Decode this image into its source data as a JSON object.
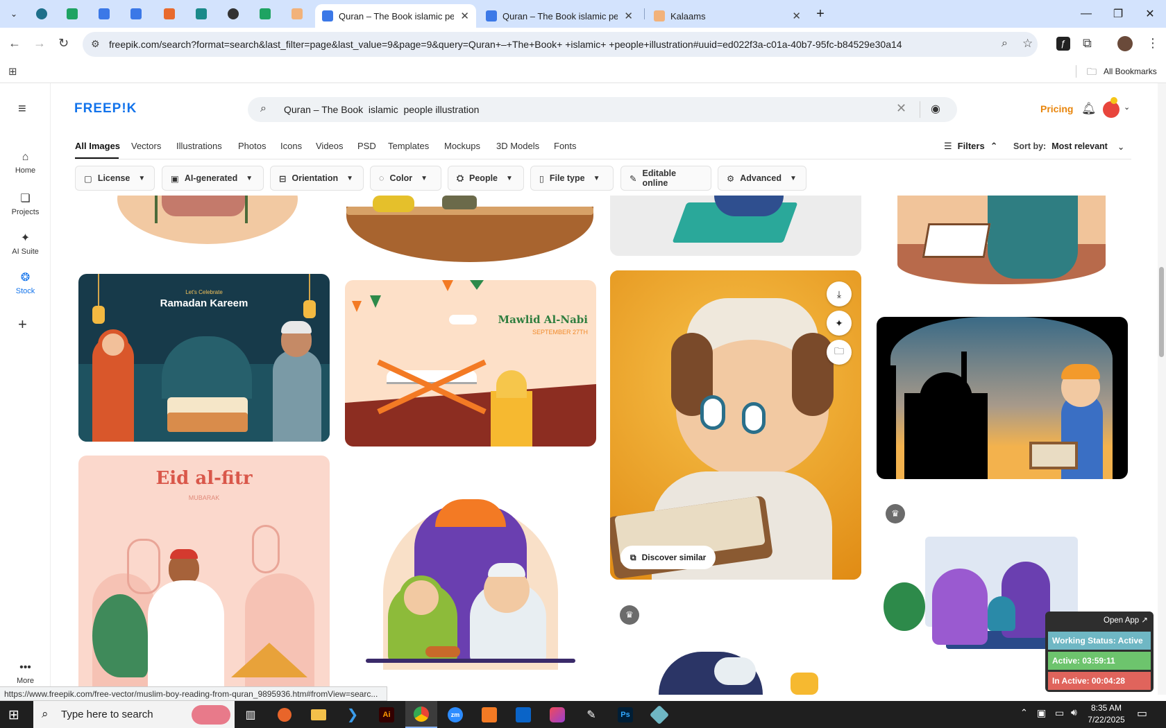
{
  "browser": {
    "tabs": [
      {
        "title": "Quran – The Book islamic peop",
        "active": true
      },
      {
        "title": "Quran – The Book islamic peop",
        "active": false
      },
      {
        "title": "Kalaams",
        "active": false
      }
    ],
    "url": "freepik.com/search?format=search&last_filter=page&last_value=9&page=9&query=Quran+–+The+Book+ +islamic+ +people+illustration#uuid=ed022f3a-c01a-40b7-95fc-b84529e30a14",
    "all_bookmarks": "All Bookmarks"
  },
  "nav": {
    "items": [
      {
        "label": "Home",
        "icon": "home-icon"
      },
      {
        "label": "Projects",
        "icon": "projects-icon"
      },
      {
        "label": "AI Suite",
        "icon": "sparkle-icon"
      },
      {
        "label": "Stock",
        "icon": "stock-icon"
      }
    ],
    "more": "More"
  },
  "header": {
    "logo": "FREEP!K",
    "search_value": "Quran – The Book  islamic  people illustration",
    "pricing": "Pricing"
  },
  "categories": [
    "All Images",
    "Vectors",
    "Illustrations",
    "Photos",
    "Icons",
    "Videos",
    "PSD",
    "Templates",
    "Mockups",
    "3D Models",
    "Fonts"
  ],
  "filters_label": "Filters",
  "sort": {
    "label": "Sort by:",
    "value": "Most relevant"
  },
  "chips": [
    {
      "label": "License",
      "icon": "license-icon"
    },
    {
      "label": "AI-generated",
      "icon": "ai-icon"
    },
    {
      "label": "Orientation",
      "icon": "orientation-icon"
    },
    {
      "label": "Color",
      "icon": "color-icon"
    },
    {
      "label": "People",
      "icon": "people-icon"
    },
    {
      "label": "File type",
      "icon": "file-icon"
    },
    {
      "label": "Editable online",
      "icon": "pen-icon"
    },
    {
      "label": "Advanced",
      "icon": "gear-icon"
    }
  ],
  "cards": {
    "ramadan_small": "Let's Celebrate",
    "ramadan_title": "Ramadan Kareem",
    "mawlid_title": "Mawlid Al-Nabi",
    "mawlid_date": "SEPTEMBER 27TH",
    "eid_title": "Eid al-fitr",
    "eid_sub": "MUBARAK",
    "discover_similar": "Discover similar"
  },
  "status_url": "https://www.freepik.com/free-vector/muslim-boy-reading-from-quran_9895936.htm#fromView=searc...",
  "widget": {
    "open_app": "Open App ↗",
    "working": "Working Status: Active",
    "active": "Active: 03:59:11",
    "inactive": "In Active: 00:04:28"
  },
  "taskbar": {
    "search_placeholder": "Type here to search",
    "time": "8:35 AM",
    "date": "7/22/2025"
  },
  "colors": {
    "brand": "#1273eb",
    "pricing": "#e8850b",
    "tabstrip": "#d3e3fd",
    "working_bg": "#6fb7c4",
    "active_bg": "#6dc46d",
    "inactive_bg": "#e0645c"
  }
}
